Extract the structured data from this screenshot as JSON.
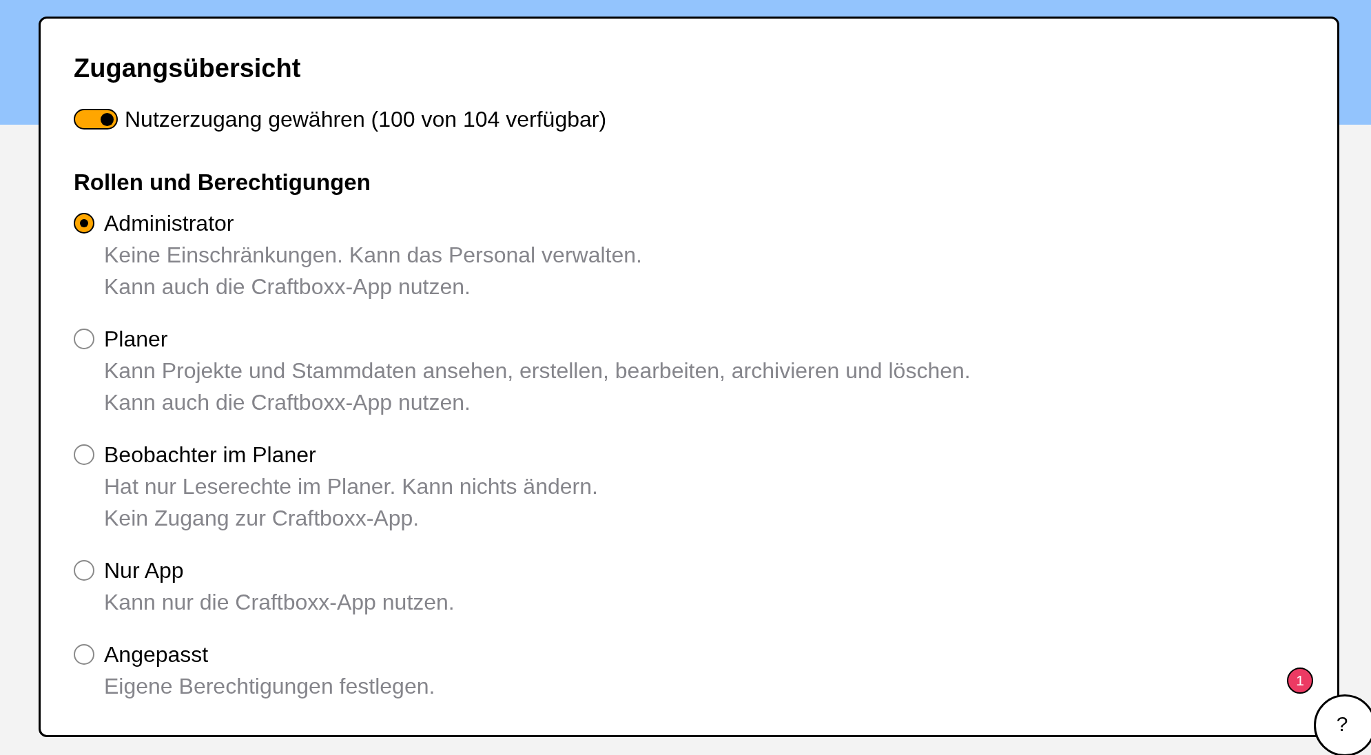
{
  "title": "Zugangsübersicht",
  "access_toggle": {
    "label": "Nutzerzugang gewähren (100 von 104 verfügbar)",
    "on": true
  },
  "roles_heading": "Rollen und Berechtigungen",
  "roles": [
    {
      "label": "Administrator",
      "selected": true,
      "description": [
        "Keine Einschränkungen. Kann das Personal verwalten.",
        "Kann auch die Craftboxx-App nutzen."
      ]
    },
    {
      "label": "Planer",
      "selected": false,
      "description": [
        "Kann Projekte und Stammdaten ansehen, erstellen, bearbeiten, archivieren und löschen.",
        "Kann auch die Craftboxx-App nutzen."
      ]
    },
    {
      "label": "Beobachter im Planer",
      "selected": false,
      "description": [
        "Hat nur Leserechte im Planer. Kann nichts ändern.",
        "Kein Zugang zur Craftboxx-App."
      ]
    },
    {
      "label": "Nur App",
      "selected": false,
      "description": [
        "Kann nur die Craftboxx-App nutzen."
      ]
    },
    {
      "label": "Angepasst",
      "selected": false,
      "description": [
        "Eigene Berechtigungen festlegen."
      ]
    }
  ],
  "help_button": {
    "label": "?",
    "badge": "1"
  }
}
